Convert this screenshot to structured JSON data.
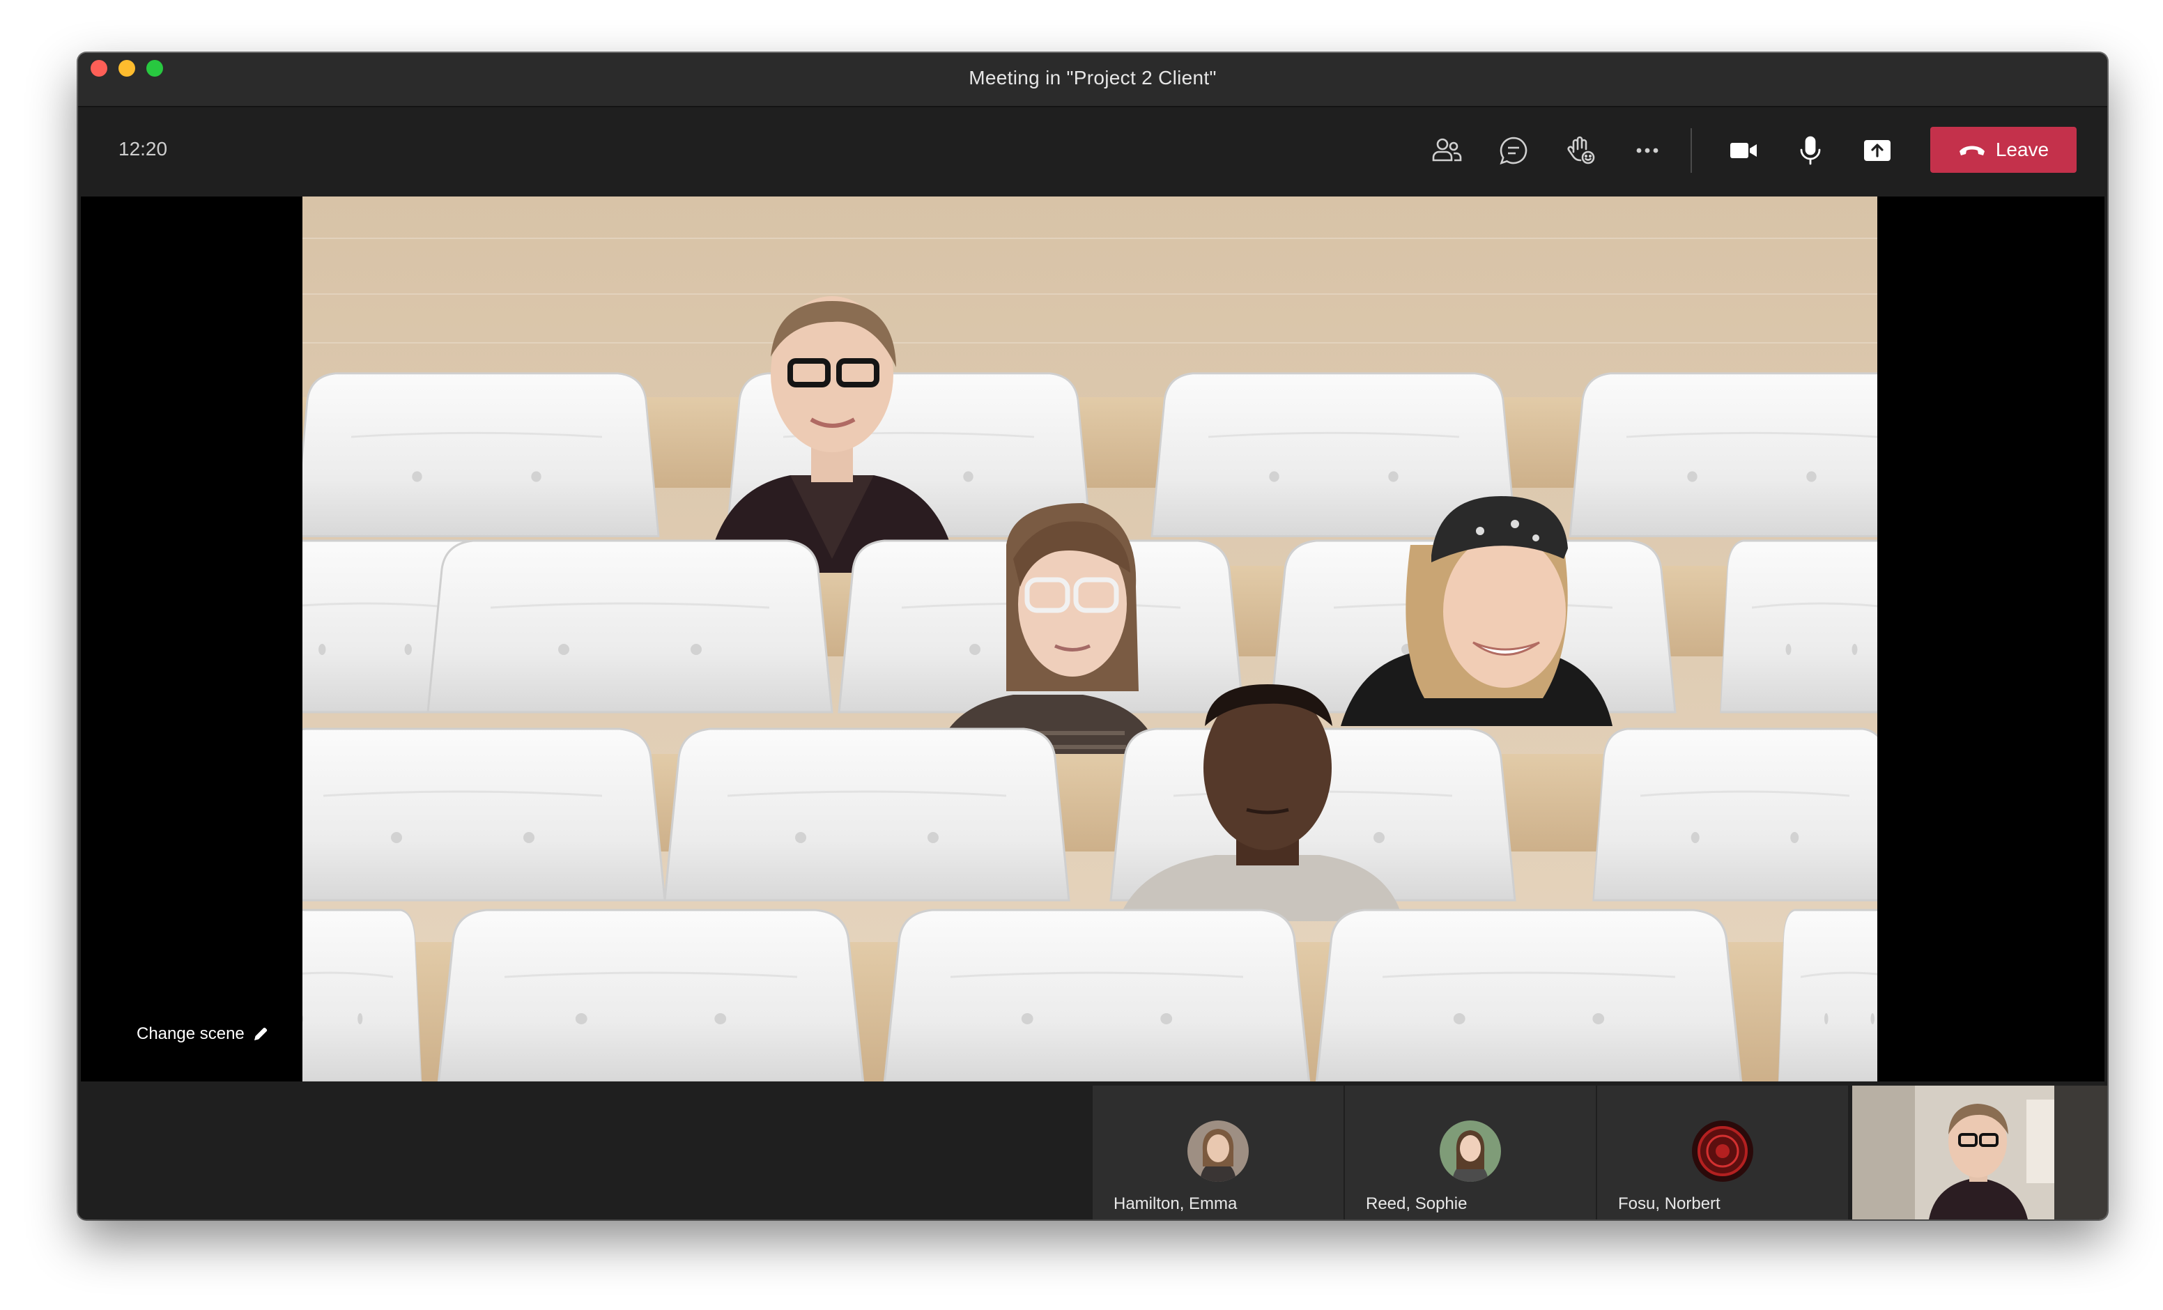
{
  "window": {
    "title": "Meeting in \"Project 2 Client\""
  },
  "toolbar": {
    "time": "12:20",
    "buttons": [
      {
        "icon": "people-icon"
      },
      {
        "icon": "chat-icon"
      },
      {
        "icon": "raise-hand-icon"
      },
      {
        "icon": "more-options-icon"
      },
      {
        "icon": "camera-icon"
      },
      {
        "icon": "microphone-icon"
      },
      {
        "icon": "share-screen-icon"
      }
    ],
    "leave_label": "Leave",
    "leave_color": "#c4314b"
  },
  "stage": {
    "mode": "Together mode auditorium",
    "change_scene_label": "Change scene"
  },
  "participants": [
    {
      "name": "Hamilton, Emma",
      "avatar": "photo"
    },
    {
      "name": "Reed, Sophie",
      "avatar": "photo"
    },
    {
      "name": "Fosu, Norbert",
      "avatar": "emblem"
    }
  ],
  "colors": {
    "window_bg": "#1f1f1f",
    "tile_bg": "#2e2e2e",
    "accent_red": "#c4314b"
  }
}
